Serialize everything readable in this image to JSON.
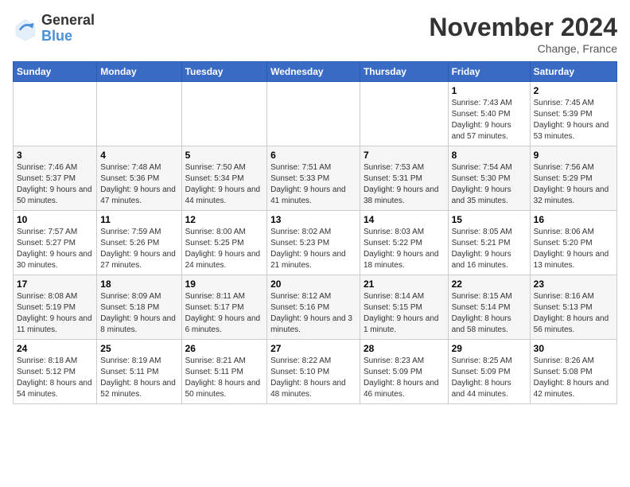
{
  "header": {
    "logo_line1": "General",
    "logo_line2": "Blue",
    "month": "November 2024",
    "location": "Change, France"
  },
  "weekdays": [
    "Sunday",
    "Monday",
    "Tuesday",
    "Wednesday",
    "Thursday",
    "Friday",
    "Saturday"
  ],
  "weeks": [
    [
      {
        "day": "",
        "info": ""
      },
      {
        "day": "",
        "info": ""
      },
      {
        "day": "",
        "info": ""
      },
      {
        "day": "",
        "info": ""
      },
      {
        "day": "",
        "info": ""
      },
      {
        "day": "1",
        "info": "Sunrise: 7:43 AM\nSunset: 5:40 PM\nDaylight: 9 hours and 57 minutes."
      },
      {
        "day": "2",
        "info": "Sunrise: 7:45 AM\nSunset: 5:39 PM\nDaylight: 9 hours and 53 minutes."
      }
    ],
    [
      {
        "day": "3",
        "info": "Sunrise: 7:46 AM\nSunset: 5:37 PM\nDaylight: 9 hours and 50 minutes."
      },
      {
        "day": "4",
        "info": "Sunrise: 7:48 AM\nSunset: 5:36 PM\nDaylight: 9 hours and 47 minutes."
      },
      {
        "day": "5",
        "info": "Sunrise: 7:50 AM\nSunset: 5:34 PM\nDaylight: 9 hours and 44 minutes."
      },
      {
        "day": "6",
        "info": "Sunrise: 7:51 AM\nSunset: 5:33 PM\nDaylight: 9 hours and 41 minutes."
      },
      {
        "day": "7",
        "info": "Sunrise: 7:53 AM\nSunset: 5:31 PM\nDaylight: 9 hours and 38 minutes."
      },
      {
        "day": "8",
        "info": "Sunrise: 7:54 AM\nSunset: 5:30 PM\nDaylight: 9 hours and 35 minutes."
      },
      {
        "day": "9",
        "info": "Sunrise: 7:56 AM\nSunset: 5:29 PM\nDaylight: 9 hours and 32 minutes."
      }
    ],
    [
      {
        "day": "10",
        "info": "Sunrise: 7:57 AM\nSunset: 5:27 PM\nDaylight: 9 hours and 30 minutes."
      },
      {
        "day": "11",
        "info": "Sunrise: 7:59 AM\nSunset: 5:26 PM\nDaylight: 9 hours and 27 minutes."
      },
      {
        "day": "12",
        "info": "Sunrise: 8:00 AM\nSunset: 5:25 PM\nDaylight: 9 hours and 24 minutes."
      },
      {
        "day": "13",
        "info": "Sunrise: 8:02 AM\nSunset: 5:23 PM\nDaylight: 9 hours and 21 minutes."
      },
      {
        "day": "14",
        "info": "Sunrise: 8:03 AM\nSunset: 5:22 PM\nDaylight: 9 hours and 18 minutes."
      },
      {
        "day": "15",
        "info": "Sunrise: 8:05 AM\nSunset: 5:21 PM\nDaylight: 9 hours and 16 minutes."
      },
      {
        "day": "16",
        "info": "Sunrise: 8:06 AM\nSunset: 5:20 PM\nDaylight: 9 hours and 13 minutes."
      }
    ],
    [
      {
        "day": "17",
        "info": "Sunrise: 8:08 AM\nSunset: 5:19 PM\nDaylight: 9 hours and 11 minutes."
      },
      {
        "day": "18",
        "info": "Sunrise: 8:09 AM\nSunset: 5:18 PM\nDaylight: 9 hours and 8 minutes."
      },
      {
        "day": "19",
        "info": "Sunrise: 8:11 AM\nSunset: 5:17 PM\nDaylight: 9 hours and 6 minutes."
      },
      {
        "day": "20",
        "info": "Sunrise: 8:12 AM\nSunset: 5:16 PM\nDaylight: 9 hours and 3 minutes."
      },
      {
        "day": "21",
        "info": "Sunrise: 8:14 AM\nSunset: 5:15 PM\nDaylight: 9 hours and 1 minute."
      },
      {
        "day": "22",
        "info": "Sunrise: 8:15 AM\nSunset: 5:14 PM\nDaylight: 8 hours and 58 minutes."
      },
      {
        "day": "23",
        "info": "Sunrise: 8:16 AM\nSunset: 5:13 PM\nDaylight: 8 hours and 56 minutes."
      }
    ],
    [
      {
        "day": "24",
        "info": "Sunrise: 8:18 AM\nSunset: 5:12 PM\nDaylight: 8 hours and 54 minutes."
      },
      {
        "day": "25",
        "info": "Sunrise: 8:19 AM\nSunset: 5:11 PM\nDaylight: 8 hours and 52 minutes."
      },
      {
        "day": "26",
        "info": "Sunrise: 8:21 AM\nSunset: 5:11 PM\nDaylight: 8 hours and 50 minutes."
      },
      {
        "day": "27",
        "info": "Sunrise: 8:22 AM\nSunset: 5:10 PM\nDaylight: 8 hours and 48 minutes."
      },
      {
        "day": "28",
        "info": "Sunrise: 8:23 AM\nSunset: 5:09 PM\nDaylight: 8 hours and 46 minutes."
      },
      {
        "day": "29",
        "info": "Sunrise: 8:25 AM\nSunset: 5:09 PM\nDaylight: 8 hours and 44 minutes."
      },
      {
        "day": "30",
        "info": "Sunrise: 8:26 AM\nSunset: 5:08 PM\nDaylight: 8 hours and 42 minutes."
      }
    ]
  ]
}
